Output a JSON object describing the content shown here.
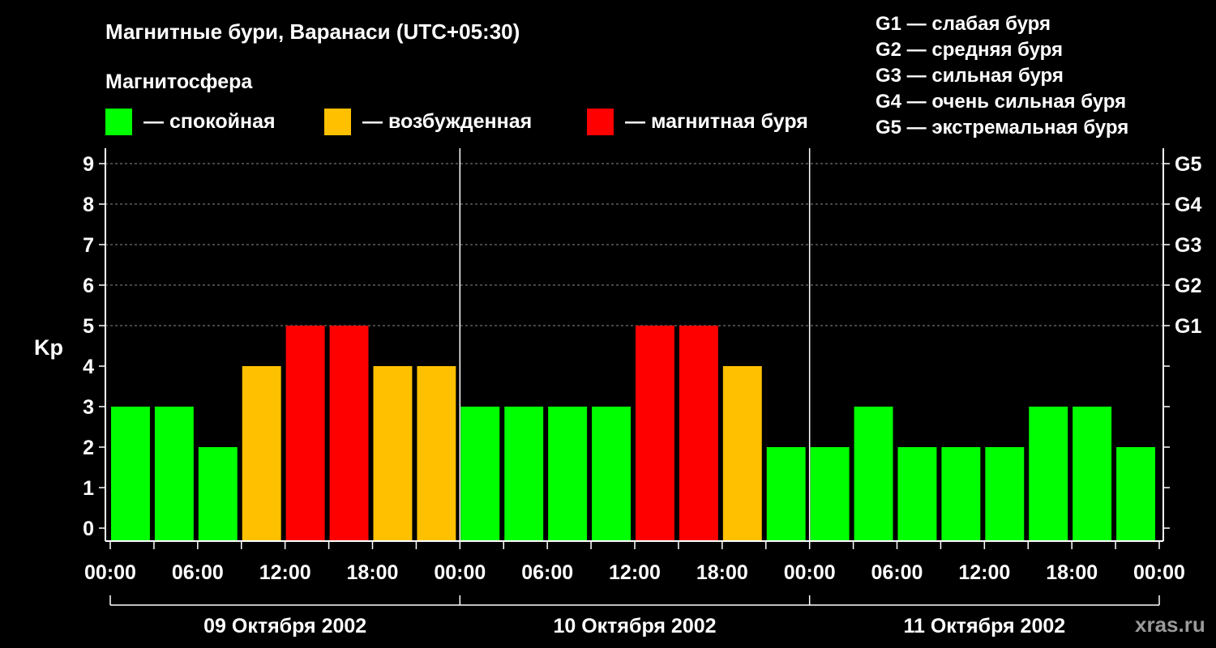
{
  "title": "Магнитные бури, Варанаси (UTC+05:30)",
  "legend": {
    "heading": "Магнитосфера",
    "items": [
      {
        "label": "— спокойная",
        "color": "#00ff00"
      },
      {
        "label": "— возбужденная",
        "color": "#ffc000"
      },
      {
        "label": "— магнитная буря",
        "color": "#ff0000"
      }
    ]
  },
  "g_legend": [
    "G1 — слабая буря",
    "G2 — средняя буря",
    "G3 — сильная буря",
    "G4 — очень сильная буря",
    "G5 — экстремальная буря"
  ],
  "watermark": "xras.ru",
  "chart_data": {
    "type": "bar",
    "ylabel": "Kp",
    "ylim": [
      0,
      9
    ],
    "yticks": [
      "0",
      "1",
      "2",
      "3",
      "4",
      "5",
      "6",
      "7",
      "8",
      "9"
    ],
    "right_ticks": [
      {
        "value": 5,
        "label": "G1"
      },
      {
        "value": 6,
        "label": "G2"
      },
      {
        "value": 7,
        "label": "G3"
      },
      {
        "value": 8,
        "label": "G4"
      },
      {
        "value": 9,
        "label": "G5"
      }
    ],
    "xticks": [
      "00:00",
      "06:00",
      "12:00",
      "18:00",
      "00:00",
      "06:00",
      "12:00",
      "18:00",
      "00:00",
      "06:00",
      "12:00",
      "18:00",
      "00:00"
    ],
    "days": [
      "09 Октября 2002",
      "10 Октября 2002",
      "11 Октября 2002"
    ],
    "grid": "horizontal dashed",
    "values": [
      3,
      3,
      2,
      4,
      5,
      5,
      4,
      4,
      3,
      3,
      3,
      3,
      5,
      5,
      4,
      2,
      2,
      3,
      2,
      2,
      2,
      3,
      3,
      2
    ],
    "colors": {
      "quiet": "#00ff00",
      "active": "#ffc000",
      "storm": "#ff0000"
    }
  }
}
